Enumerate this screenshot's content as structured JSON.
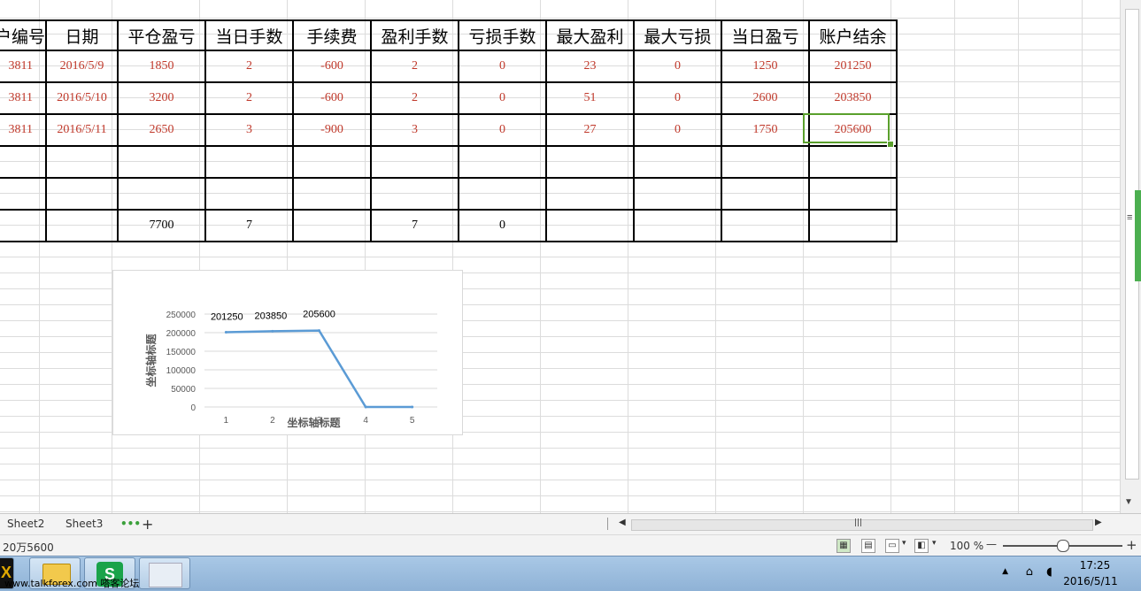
{
  "headers": [
    "户编号",
    "日期",
    "平仓盈亏",
    "当日手数",
    "手续费",
    "盈利手数",
    "亏损手数",
    "最大盈利",
    "最大亏损",
    "当日盈亏",
    "账户结余"
  ],
  "rows": [
    [
      "3811",
      "2016/5/9",
      "1850",
      "2",
      "-600",
      "2",
      "0",
      "23",
      "0",
      "1250",
      "201250"
    ],
    [
      "3811",
      "2016/5/10",
      "3200",
      "2",
      "-600",
      "2",
      "0",
      "51",
      "0",
      "2600",
      "203850"
    ],
    [
      "3811",
      "2016/5/11",
      "2650",
      "3",
      "-900",
      "3",
      "0",
      "27",
      "0",
      "1750",
      "205600"
    ],
    [
      "",
      "",
      "",
      "",
      "",
      "",
      "",
      "",
      "",
      "",
      ""
    ],
    [
      "",
      "",
      "",
      "",
      "",
      "",
      "",
      "",
      "",
      "",
      ""
    ],
    [
      "",
      "",
      "7700",
      "7",
      "",
      "7",
      "0",
      "",
      "",
      "",
      ""
    ]
  ],
  "chart_data": {
    "type": "line",
    "categories": [
      "1",
      "2",
      "3",
      "4",
      "5"
    ],
    "series": [
      {
        "values": [
          201250,
          203850,
          205600,
          0,
          0
        ],
        "color": "#5b9bd5"
      }
    ],
    "data_labels": [
      "201250",
      "203850",
      "205600"
    ],
    "ylim": [
      0,
      250000
    ],
    "yticks": [
      "250000",
      "200000",
      "150000",
      "100000",
      "50000",
      "0"
    ],
    "xlabel": "坐标轴标题",
    "ylabel": "坐标轴标题",
    "grid": true
  },
  "tabs": {
    "sheet2": "Sheet2",
    "sheet3": "Sheet3",
    "more": "•••",
    "add": "+"
  },
  "status": {
    "cell_value": "20万5600",
    "zoom": "100 %",
    "zoom_minus": "—",
    "zoom_plus": "+"
  },
  "taskbar": {
    "watermark": "www.talkforex.com 嗒客论坛",
    "time": "17:25",
    "date": "2016/5/11"
  },
  "colors": {
    "selection": "#5aa02c",
    "red_text": "#c0392b",
    "series": "#5b9bd5"
  }
}
